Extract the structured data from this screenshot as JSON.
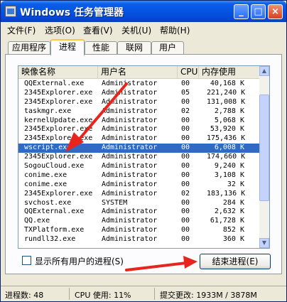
{
  "window": {
    "title": "Windows 任务管理器",
    "buttons": {
      "minimize": "_",
      "maximize": "□",
      "close": "×"
    }
  },
  "menu": [
    "文件(F)",
    "选项(O)",
    "查看(V)",
    "关机(U)",
    "帮助(H)"
  ],
  "tabs": [
    "应用程序",
    "进程",
    "性能",
    "联网",
    "用户"
  ],
  "active_tab": "进程",
  "columns": [
    "映像名称",
    "用户名",
    "CPU",
    "内存使用"
  ],
  "rows": [
    {
      "name": "QQExternal.exe",
      "user": "Administrator",
      "cpu": "00",
      "mem": "40,168 K"
    },
    {
      "name": "2345Explorer.exe",
      "user": "Administrator",
      "cpu": "05",
      "mem": "221,240 K"
    },
    {
      "name": "2345Explorer.exe",
      "user": "Administrator",
      "cpu": "00",
      "mem": "131,008 K"
    },
    {
      "name": "taskmgr.exe",
      "user": "Administrator",
      "cpu": "02",
      "mem": "2,788 K"
    },
    {
      "name": "kernelUpdate.exe",
      "user": "Administrator",
      "cpu": "00",
      "mem": "5,068 K"
    },
    {
      "name": "2345Explorer.exe",
      "user": "Administrator",
      "cpu": "00",
      "mem": "53,920 K"
    },
    {
      "name": "2345Explorer.exe",
      "user": "Administrator",
      "cpu": "00",
      "mem": "175,436 K"
    },
    {
      "name": "wscript.exe",
      "user": "Administrator",
      "cpu": "00",
      "mem": "6,008 K",
      "selected": true
    },
    {
      "name": "2345Explorer.exe",
      "user": "Administrator",
      "cpu": "00",
      "mem": "174,660 K"
    },
    {
      "name": "SogouCloud.exe",
      "user": "Administrator",
      "cpu": "00",
      "mem": "9,240 K"
    },
    {
      "name": "conime.exe",
      "user": "Administrator",
      "cpu": "00",
      "mem": "3,108 K"
    },
    {
      "name": "conime.exe",
      "user": "Administrator",
      "cpu": "00",
      "mem": "32 K"
    },
    {
      "name": "2345Explorer.exe",
      "user": "Administrator",
      "cpu": "02",
      "mem": "183,136 K"
    },
    {
      "name": "svchost.exe",
      "user": "SYSTEM",
      "cpu": "00",
      "mem": "284 K"
    },
    {
      "name": "QQExternal.exe",
      "user": "Administrator",
      "cpu": "00",
      "mem": "2,632 K"
    },
    {
      "name": "QQ.exe",
      "user": "Administrator",
      "cpu": "00",
      "mem": "61,728 K"
    },
    {
      "name": "TXPlatform.exe",
      "user": "Administrator",
      "cpu": "00",
      "mem": "852 K"
    },
    {
      "name": "rundll32.exe",
      "user": "Administrator",
      "cpu": "00",
      "mem": "360 K"
    }
  ],
  "show_all_users_label": "显示所有用户的进程(S)",
  "end_process_label": "结束进程(E)",
  "status": {
    "processes": "进程数: 48",
    "cpu": "CPU 使用: 11%",
    "commit": "提交更改: 1933M / 3878M"
  },
  "colors": {
    "title_bar": "#0554e1",
    "selection": "#316ac5",
    "annotation_arrow": "#e8251c"
  }
}
